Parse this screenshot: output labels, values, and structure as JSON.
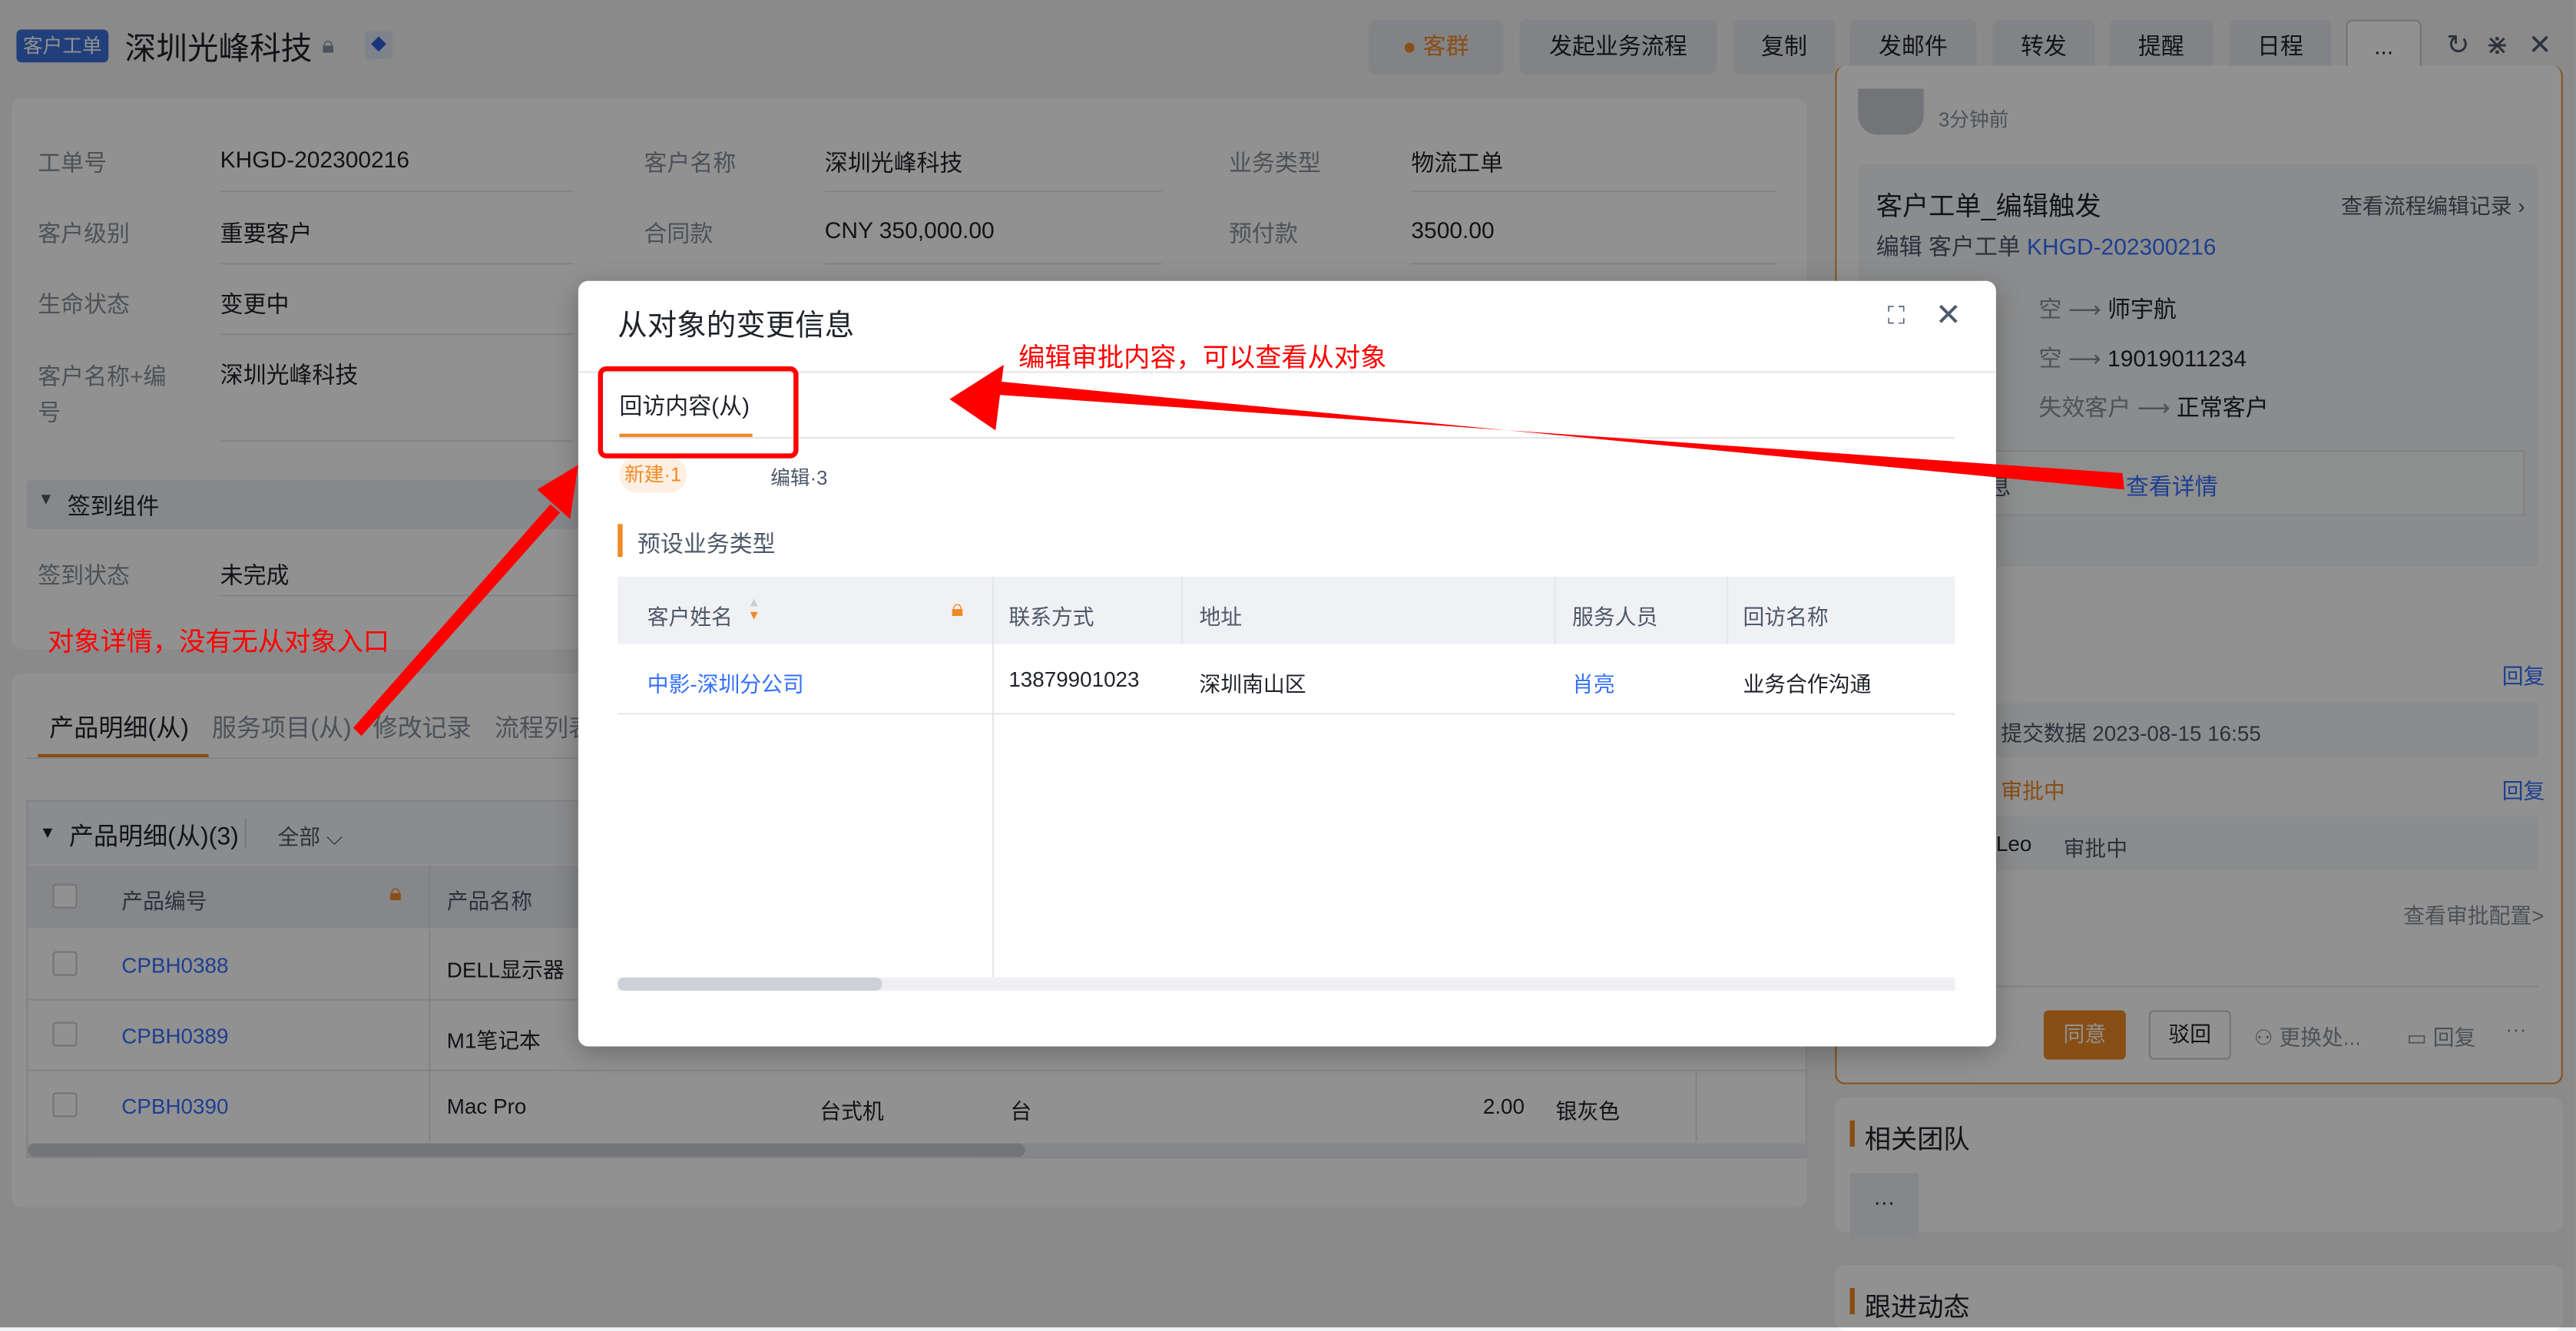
{
  "header": {
    "tag": "客户工单",
    "title": "深圳光峰科技",
    "buttons": [
      {
        "label": "客群"
      },
      {
        "label": "发起业务流程"
      },
      {
        "label": "复制"
      },
      {
        "label": "发邮件"
      },
      {
        "label": "转发"
      },
      {
        "label": "提醒"
      },
      {
        "label": "日程"
      },
      {
        "label": "..."
      }
    ],
    "icons": [
      "refresh-icon",
      "collapse-icon",
      "close-icon"
    ]
  },
  "fields": [
    {
      "label": "工单号",
      "value": "KHGD-202300216"
    },
    {
      "label": "客户名称",
      "value": "深圳光峰科技"
    },
    {
      "label": "业务类型",
      "value": "物流工单"
    },
    {
      "label": "客户级别",
      "value": "重要客户"
    },
    {
      "label": "合同款",
      "value": "CNY 350,000.00"
    },
    {
      "label": "预付款",
      "value": "3500.00"
    },
    {
      "label": "生命状态",
      "value": "变更中"
    },
    {
      "label": "客户名称+编号",
      "value": "深圳光峰科技"
    }
  ],
  "checkin": {
    "section": "签到组件",
    "label": "签到状态",
    "value": "未完成"
  },
  "detail_tabs": [
    "产品明细(从)",
    "服务项目(从)",
    "修改记录",
    "流程列表"
  ],
  "product_table": {
    "title": "产品明细(从)(3)",
    "filter": "全部",
    "headers": [
      "产品编号",
      "产品名称"
    ],
    "rows": [
      {
        "code": "CPBH0388",
        "name": "DELL显示器"
      },
      {
        "code": "CPBH0389",
        "name": "M1笔记本"
      },
      {
        "code": "CPBH0390",
        "name": "Mac Pro",
        "type": "台式机",
        "unit": "台",
        "qty": "2.00",
        "color": "银灰色"
      }
    ]
  },
  "right": {
    "time": "3分钟前",
    "flow_title": "客户工单_编辑触发",
    "flow_link": "查看流程编辑记录",
    "edit_prefix": "编辑 客户工单",
    "edit_id": "KHGD-202300216",
    "changes": [
      {
        "from": "空",
        "to": "师宇航"
      },
      {
        "from": "空",
        "to": "19019011234"
      },
      {
        "from": "失效客户",
        "to": "正常客户"
      }
    ],
    "change_info": "变更信息",
    "view_detail": "查看详情",
    "reply": "回复",
    "submit": "提交数据 2023-08-15 16:55",
    "status": "审批中",
    "approver": "Leo",
    "approver_status": "审批中",
    "view_config": "查看审批配置>",
    "agree": "同意",
    "reject": "驳回",
    "transfer": "更换处...",
    "reply2": "回复",
    "more": "···",
    "team": "相关团队",
    "team_more": "···",
    "follow": "跟进动态"
  },
  "modal": {
    "title": "从对象的变更信息",
    "tab": "回访内容(从)",
    "pills": [
      "新建·1",
      "编辑·3"
    ],
    "section": "预设业务类型",
    "headers": [
      "客户姓名",
      "联系方式",
      "地址",
      "服务人员",
      "回访名称"
    ],
    "rows": [
      [
        "中影-深圳分公司",
        "13879901023",
        "深圳南山区",
        "肖亮",
        "业务合作沟通"
      ]
    ]
  },
  "annotations": {
    "top": "编辑审批内容，可以查看从对象",
    "left": "对象详情，没有无从对象入口"
  }
}
